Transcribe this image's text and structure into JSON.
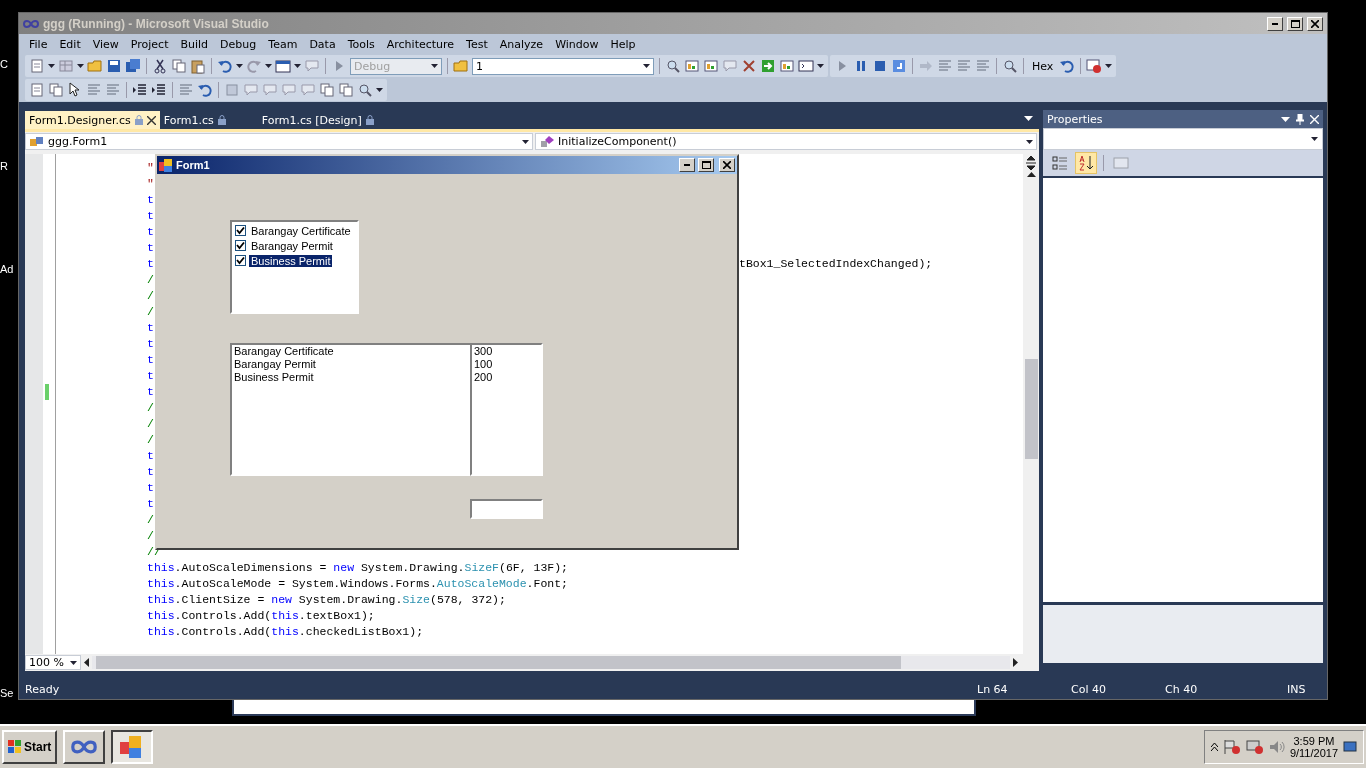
{
  "desktop": {
    "labels": [
      "C",
      "R",
      "Ad",
      "Se"
    ]
  },
  "window": {
    "title": "ggg (Running) - Microsoft Visual Studio"
  },
  "menu": [
    "File",
    "Edit",
    "View",
    "Project",
    "Build",
    "Debug",
    "Team",
    "Data",
    "Tools",
    "Architecture",
    "Test",
    "Analyze",
    "Window",
    "Help"
  ],
  "toolbar": {
    "configuration": {
      "value": "Debug",
      "disabled": true
    },
    "find": {
      "value": "1"
    },
    "hex": "Hex"
  },
  "tabs": [
    {
      "label": "Form1.Designer.cs",
      "selected": true
    },
    {
      "label": "Form1.cs",
      "selected": false
    },
    {
      "label": "Form1.cs [Design]",
      "selected": false
    }
  ],
  "navigation": {
    "type": "ggg.Form1",
    "member": "InitializeComponent()"
  },
  "code": {
    "lines": [
      {
        "changed": false,
        "left": [
          {
            "kind": "string",
            "text": "\""
          }
        ]
      },
      {
        "changed": false,
        "left": [
          {
            "kind": "string",
            "text": "\""
          }
        ]
      },
      {
        "changed": false,
        "left": [
          {
            "kind": "keyword",
            "text": "t"
          }
        ]
      },
      {
        "changed": false,
        "left": [
          {
            "kind": "keyword",
            "text": "t"
          }
        ]
      },
      {
        "changed": false,
        "left": [
          {
            "kind": "keyword",
            "text": "t"
          }
        ]
      },
      {
        "changed": false,
        "left": [
          {
            "kind": "keyword",
            "text": "t"
          }
        ]
      },
      {
        "changed": false,
        "left": [
          {
            "kind": "keyword",
            "text": "t"
          }
        ],
        "right": [
          {
            "kind": "plain",
            "text": "tBox1_SelectedIndexChanged);"
          }
        ]
      },
      {
        "changed": false,
        "left": [
          {
            "kind": "comment",
            "text": "/"
          }
        ]
      },
      {
        "changed": false,
        "left": [
          {
            "kind": "comment",
            "text": "/"
          }
        ]
      },
      {
        "changed": false,
        "left": [
          {
            "kind": "comment",
            "text": "/"
          }
        ]
      },
      {
        "changed": false,
        "left": [
          {
            "kind": "keyword",
            "text": "t"
          }
        ]
      },
      {
        "changed": false,
        "left": [
          {
            "kind": "keyword",
            "text": "t"
          }
        ]
      },
      {
        "changed": false,
        "left": [
          {
            "kind": "keyword",
            "text": "t"
          }
        ]
      },
      {
        "changed": false,
        "left": [
          {
            "kind": "keyword",
            "text": "t"
          }
        ]
      },
      {
        "changed": true,
        "left": [
          {
            "kind": "keyword",
            "text": "t"
          }
        ]
      },
      {
        "changed": false,
        "left": [
          {
            "kind": "comment",
            "text": "/"
          }
        ]
      },
      {
        "changed": false,
        "left": [
          {
            "kind": "comment",
            "text": "/"
          }
        ]
      },
      {
        "changed": false,
        "left": [
          {
            "kind": "comment",
            "text": "/"
          }
        ]
      },
      {
        "changed": false,
        "left": [
          {
            "kind": "keyword",
            "text": "t"
          }
        ]
      },
      {
        "changed": false,
        "left": [
          {
            "kind": "keyword",
            "text": "t"
          }
        ]
      },
      {
        "changed": false,
        "left": [
          {
            "kind": "keyword",
            "text": "t"
          }
        ]
      },
      {
        "changed": false,
        "left": [
          {
            "kind": "keyword",
            "text": "t"
          }
        ]
      },
      {
        "changed": false,
        "left": [
          {
            "kind": "comment",
            "text": "/"
          }
        ]
      },
      {
        "changed": false,
        "left": [
          {
            "kind": "comment",
            "text": "/"
          }
        ]
      },
      {
        "changed": false,
        "left": [
          {
            "kind": "comment",
            "text": "//"
          }
        ]
      },
      {
        "changed": false,
        "left": [
          {
            "kind": "keyword",
            "text": "this"
          },
          {
            "kind": "plain",
            "text": ".AutoScaleDimensions = "
          },
          {
            "kind": "keyword",
            "text": "new"
          },
          {
            "kind": "plain",
            "text": " System.Drawing."
          },
          {
            "kind": "type",
            "text": "SizeF"
          },
          {
            "kind": "plain",
            "text": "(6F, 13F);"
          }
        ]
      },
      {
        "changed": false,
        "left": [
          {
            "kind": "keyword",
            "text": "this"
          },
          {
            "kind": "plain",
            "text": ".AutoScaleMode = System.Windows.Forms."
          },
          {
            "kind": "type",
            "text": "AutoScaleMode"
          },
          {
            "kind": "plain",
            "text": ".Font;"
          }
        ]
      },
      {
        "changed": false,
        "left": [
          {
            "kind": "keyword",
            "text": "this"
          },
          {
            "kind": "plain",
            "text": ".ClientSize = "
          },
          {
            "kind": "keyword",
            "text": "new"
          },
          {
            "kind": "plain",
            "text": " System.Drawing."
          },
          {
            "kind": "type",
            "text": "Size"
          },
          {
            "kind": "plain",
            "text": "(578, 372);"
          }
        ]
      },
      {
        "changed": false,
        "left": [
          {
            "kind": "keyword",
            "text": "this"
          },
          {
            "kind": "plain",
            "text": ".Controls.Add("
          },
          {
            "kind": "keyword",
            "text": "this"
          },
          {
            "kind": "plain",
            "text": ".textBox1);"
          }
        ]
      },
      {
        "changed": false,
        "left": [
          {
            "kind": "keyword",
            "text": "this"
          },
          {
            "kind": "plain",
            "text": ".Controls.Add("
          },
          {
            "kind": "keyword",
            "text": "this"
          },
          {
            "kind": "plain",
            "text": ".checkedListBox1);"
          }
        ]
      }
    ]
  },
  "editor": {
    "zoom": "100 %"
  },
  "form": {
    "title": "Form1",
    "checked_list": [
      {
        "label": "Barangay Certificate",
        "checked": true,
        "selected": false
      },
      {
        "label": "Barangay Permit",
        "checked": true,
        "selected": false
      },
      {
        "label": "Business Permit",
        "checked": true,
        "selected": true
      }
    ],
    "names": [
      "Barangay Certificate",
      "Barangay Permit",
      "Business Permit"
    ],
    "prices": [
      "300",
      "100",
      "200"
    ]
  },
  "properties": {
    "title": "Properties",
    "sort_buttons": [
      {
        "kind": "categorized",
        "selected": false
      },
      {
        "kind": "alphabetical",
        "selected": true
      },
      {
        "kind": "pages",
        "selected": false
      }
    ]
  },
  "status": {
    "text": "Ready",
    "line": "Ln 64",
    "column": "Col 40",
    "char": "Ch 40",
    "mode": "INS"
  },
  "taskbar": {
    "start": "Start",
    "time": "3:59 PM",
    "date": "9/11/2017"
  }
}
